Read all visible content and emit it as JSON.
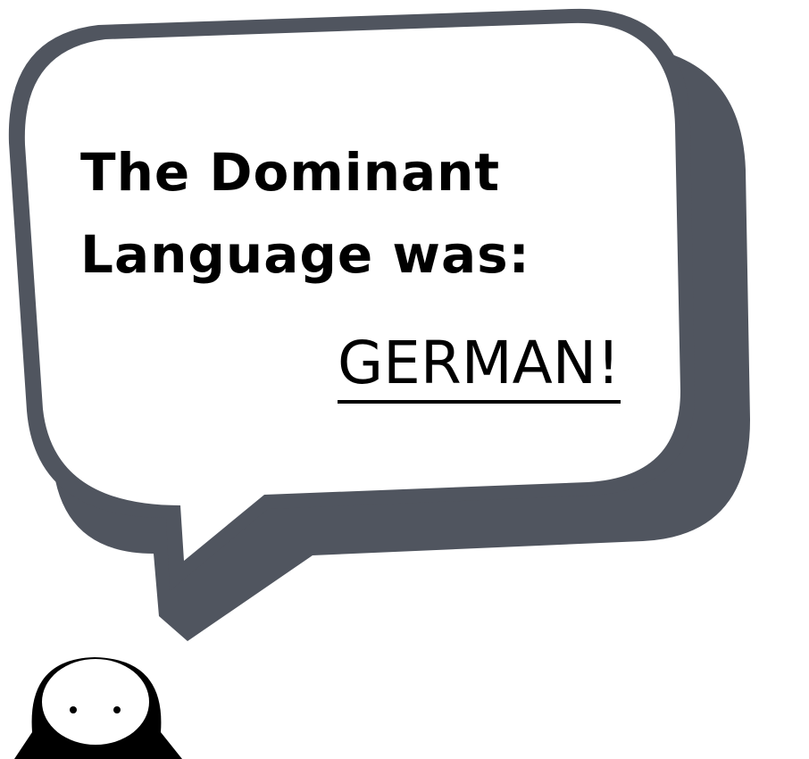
{
  "speech_bubble": {
    "line_1": "The Dominant",
    "line_2": "Language was:",
    "answer": "GERMAN!"
  },
  "colors": {
    "bubble_fill": "#ffffff",
    "bubble_border": "#50555f",
    "bubble_shadow": "#50555f",
    "character_body": "#000000",
    "character_face": "#ffffff",
    "text": "#000000"
  },
  "icons": {
    "character": "round-character-icon"
  }
}
